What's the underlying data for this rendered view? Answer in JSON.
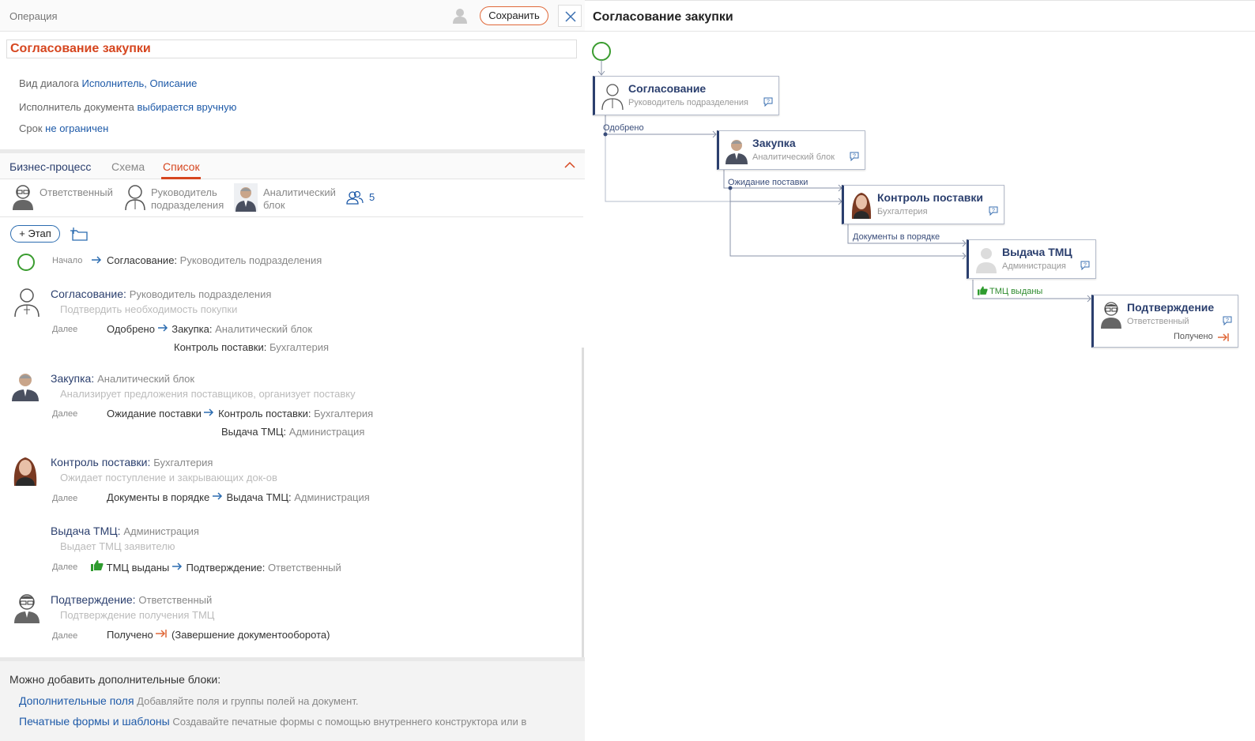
{
  "header": {
    "title": "Операция",
    "save_label": "Сохранить"
  },
  "operation_name": "Согласование закупки",
  "properties": [
    {
      "label": "Вид диалога",
      "value": "Исполнитель, Описание"
    },
    {
      "label": "Исполнитель документа",
      "value": "выбирается вручную"
    },
    {
      "label": "Срок",
      "value": "не ограничен"
    }
  ],
  "tabs": [
    "Бизнес-процесс",
    "Схема",
    "Список"
  ],
  "active_tab": "Список",
  "roles": [
    {
      "name": "Ответственный"
    },
    {
      "name_line1": "Руководитель",
      "name_line2": "подразделения"
    },
    {
      "name_line1": "Аналитический",
      "name_line2": "блок"
    }
  ],
  "participants_count": "5",
  "add_stage_label": "+ Этап",
  "start": {
    "label": "Начало",
    "target": "Согласование:",
    "target_role": "Руководитель подразделения"
  },
  "next_label": "Далее",
  "stages": [
    {
      "title": "Согласование:",
      "role": "Руководитель подразделения",
      "desc": "Подтвердить необходимость покупки",
      "transitions": [
        {
          "result": "Одобрено",
          "target": "Закупка:",
          "target_role": "Аналитический блок"
        },
        {
          "target": "Контроль поставки:",
          "target_role": "Бухгалтерия"
        }
      ]
    },
    {
      "title": "Закупка:",
      "role": "Аналитический блок",
      "desc": "Анализирует предложения поставщиков, организует поставку",
      "transitions": [
        {
          "result": "Ожидание поставки",
          "target": "Контроль поставки:",
          "target_role": "Бухгалтерия"
        },
        {
          "target": "Выдача ТМЦ:",
          "target_role": "Администрация"
        }
      ]
    },
    {
      "title": "Контроль поставки:",
      "role": "Бухгалтерия",
      "desc": "Ожидает поступление и закрывающих док-ов",
      "transitions": [
        {
          "result": "Документы в порядке",
          "target": "Выдача ТМЦ:",
          "target_role": "Администрация"
        }
      ]
    },
    {
      "title": "Выдача ТМЦ:",
      "role": "Администрация",
      "desc": "Выдает ТМЦ заявителю",
      "transitions": [
        {
          "result": "ТМЦ выданы",
          "target": "Подтверждение:",
          "target_role": "Ответственный"
        }
      ]
    },
    {
      "title": "Подтверждение:",
      "role": "Ответственный",
      "desc": "Подтверждение получения ТМЦ",
      "transitions": [
        {
          "result": "Получено",
          "target": "(Завершение документооборота)"
        }
      ]
    }
  ],
  "addons": {
    "title": "Можно добавить дополнительные блоки:",
    "items": [
      {
        "link": "Дополнительные поля",
        "desc": "Добавляйте поля и группы полей на документ."
      },
      {
        "link": "Печатные формы и шаблоны",
        "desc": "Создавайте печатные формы с помощью внутреннего конструктора или в"
      }
    ]
  },
  "diagram": {
    "title": "Согласование закупки",
    "nodes": [
      {
        "title": "Согласование",
        "subtitle": "Руководитель подразделения"
      },
      {
        "title": "Закупка",
        "subtitle": "Аналитический блок"
      },
      {
        "title": "Контроль поставки",
        "subtitle": "Бухгалтерия"
      },
      {
        "title": "Выдача ТМЦ",
        "subtitle": "Администрация"
      },
      {
        "title": "Подтверждение",
        "subtitle": "Ответственный",
        "end_label": "Получено"
      }
    ],
    "edges": [
      "Одобрено",
      "Ожидание поставки",
      "Документы в порядке",
      "ТМЦ выданы"
    ]
  },
  "colors": {
    "accent": "#d6461f",
    "link": "#1e5aa8",
    "node_border": "#2b3f6e",
    "start": "#3a9c2f",
    "thumb": "#2e9b2e"
  }
}
